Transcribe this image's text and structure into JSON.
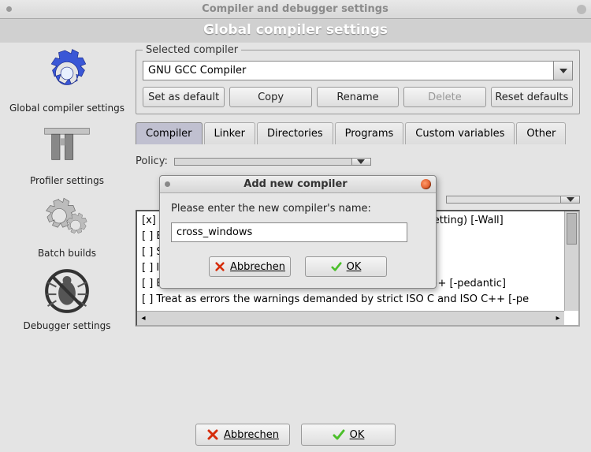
{
  "window": {
    "title": "Compiler and debugger settings",
    "subtitle": "Global compiler settings"
  },
  "sidebar": {
    "items": [
      {
        "label": "Global compiler settings"
      },
      {
        "label": "Profiler settings"
      },
      {
        "label": "Batch builds"
      },
      {
        "label": "Debugger settings"
      }
    ]
  },
  "selectedCompiler": {
    "legend": "Selected compiler",
    "value": "GNU GCC Compiler",
    "buttons": {
      "setDefault": "Set as default",
      "copy": "Copy",
      "rename": "Rename",
      "delete": "Delete",
      "reset": "Reset defaults"
    }
  },
  "tabs": [
    {
      "label": "Compiler"
    },
    {
      "label": "Linker"
    },
    {
      "label": "Directories"
    },
    {
      "label": "Programs"
    },
    {
      "label": "Custom variables"
    },
    {
      "label": "Other"
    }
  ],
  "policy": {
    "label": "Policy:",
    "value": ""
  },
  "flags": {
    "lines": [
      "[x] Enable all compiler warnings (overrides every other setting)  [-Wall]",
      "[ ] Enable standard compiler warnings  [-W]",
      "[ ] Stop compiling after first error  [-Wfatal-errors]",
      "[ ] Inhibit all warning messages  [-w]",
      "[ ] Enable warnings demanded by strict ISO C and ISO C++  [-pedantic]",
      "[ ] Treat as errors the warnings demanded by strict ISO C and ISO C++  [-pe"
    ]
  },
  "bottom": {
    "cancel": "Abbrechen",
    "ok": "OK"
  },
  "dialog": {
    "title": "Add new compiler",
    "prompt": "Please enter the new compiler's name:",
    "input": "cross_windows",
    "cancel": "Abbrechen",
    "ok": "OK"
  }
}
